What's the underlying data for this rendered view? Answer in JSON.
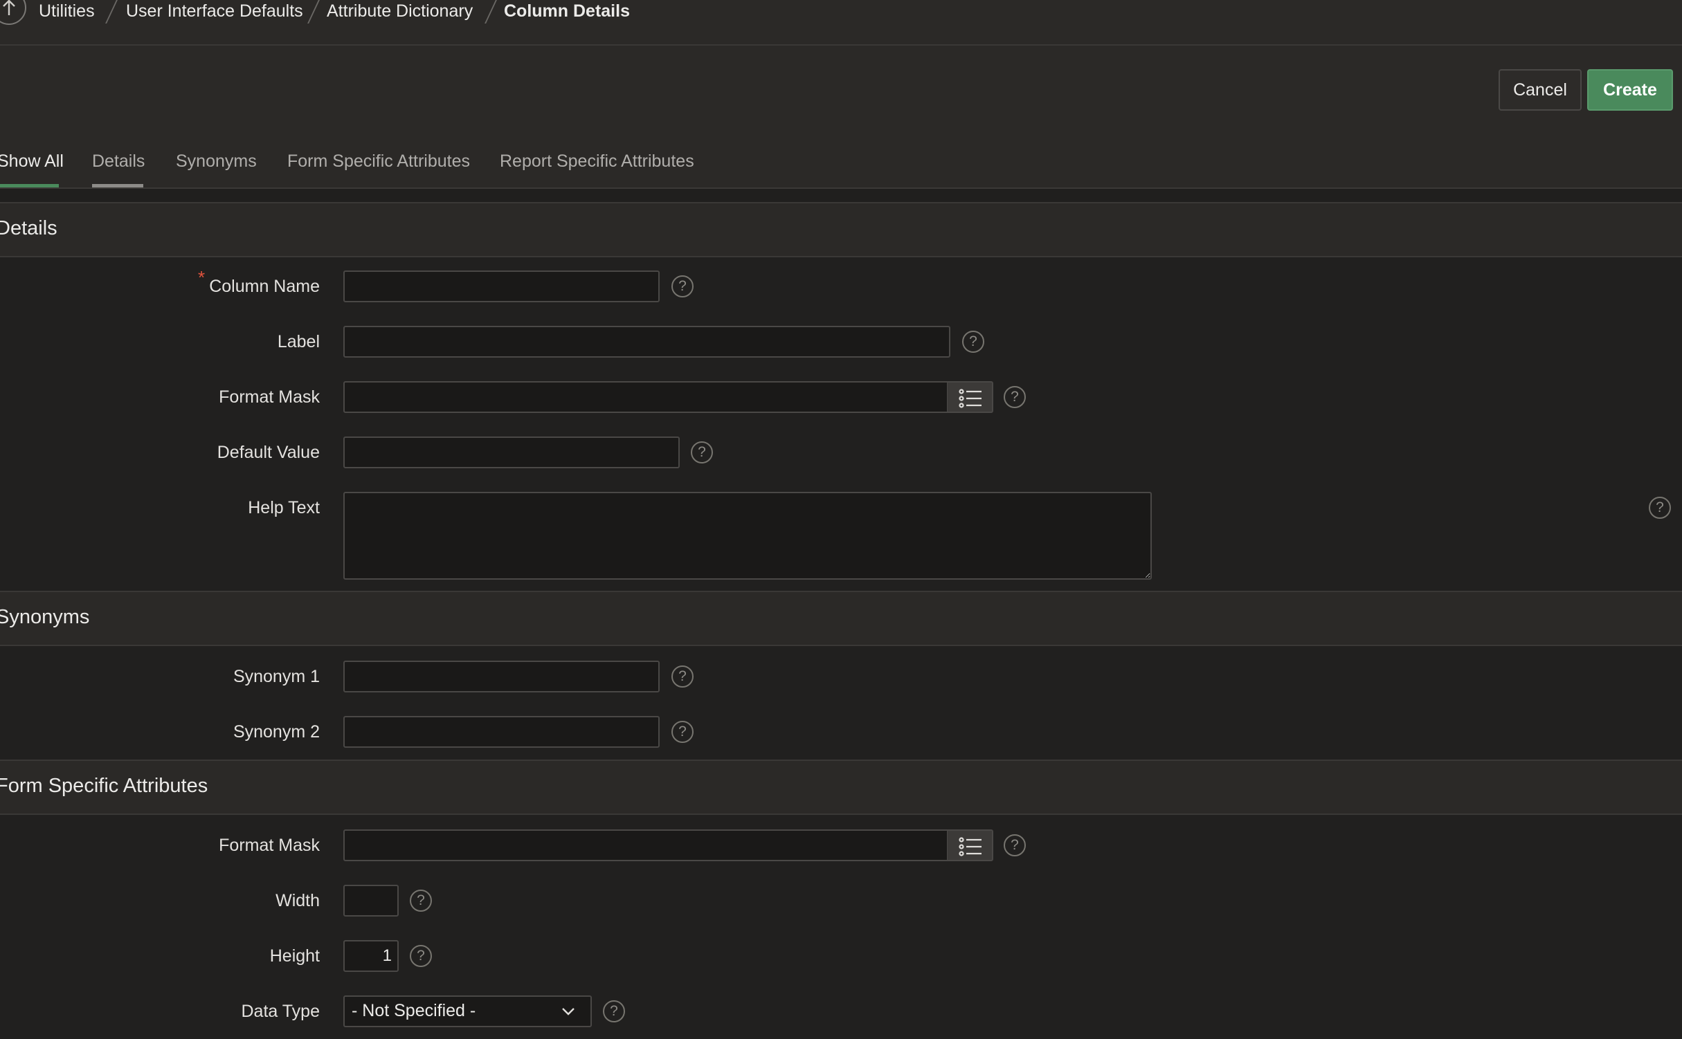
{
  "breadcrumb": {
    "up_icon": "arrow-up-icon",
    "items": [
      "Utilities",
      "User Interface Defaults",
      "Attribute Dictionary",
      "Column Details"
    ]
  },
  "buttons": {
    "cancel": "Cancel",
    "create": "Create"
  },
  "tabs": [
    "Show All",
    "Details",
    "Synonyms",
    "Form Specific Attributes",
    "Report Specific Attributes"
  ],
  "colors": {
    "primary_button": "#4a8a5c",
    "active_tab_underline": "#4a8a5c",
    "required_marker": "#e0533d",
    "background": "#201f1e"
  },
  "sections": {
    "details": {
      "title": "Details",
      "required_marker": "*",
      "column_name": {
        "label": "Column Name",
        "value": ""
      },
      "label": {
        "label": "Label",
        "value": ""
      },
      "format_mask": {
        "label": "Format Mask",
        "value": "",
        "lov_icon": "list-icon"
      },
      "default_value": {
        "label": "Default Value",
        "value": ""
      },
      "help_text": {
        "label": "Help Text",
        "value": ""
      }
    },
    "synonyms": {
      "title": "Synonyms",
      "synonym_1": {
        "label": "Synonym 1",
        "value": ""
      },
      "synonym_2": {
        "label": "Synonym 2",
        "value": ""
      }
    },
    "form_specific": {
      "title": "Form Specific Attributes",
      "format_mask": {
        "label": "Format Mask",
        "value": "",
        "lov_icon": "list-icon"
      },
      "width": {
        "label": "Width",
        "value": ""
      },
      "height": {
        "label": "Height",
        "value": "1"
      },
      "data_type": {
        "label": "Data Type",
        "value": "- Not Specified -"
      }
    }
  },
  "help_glyph": "?"
}
